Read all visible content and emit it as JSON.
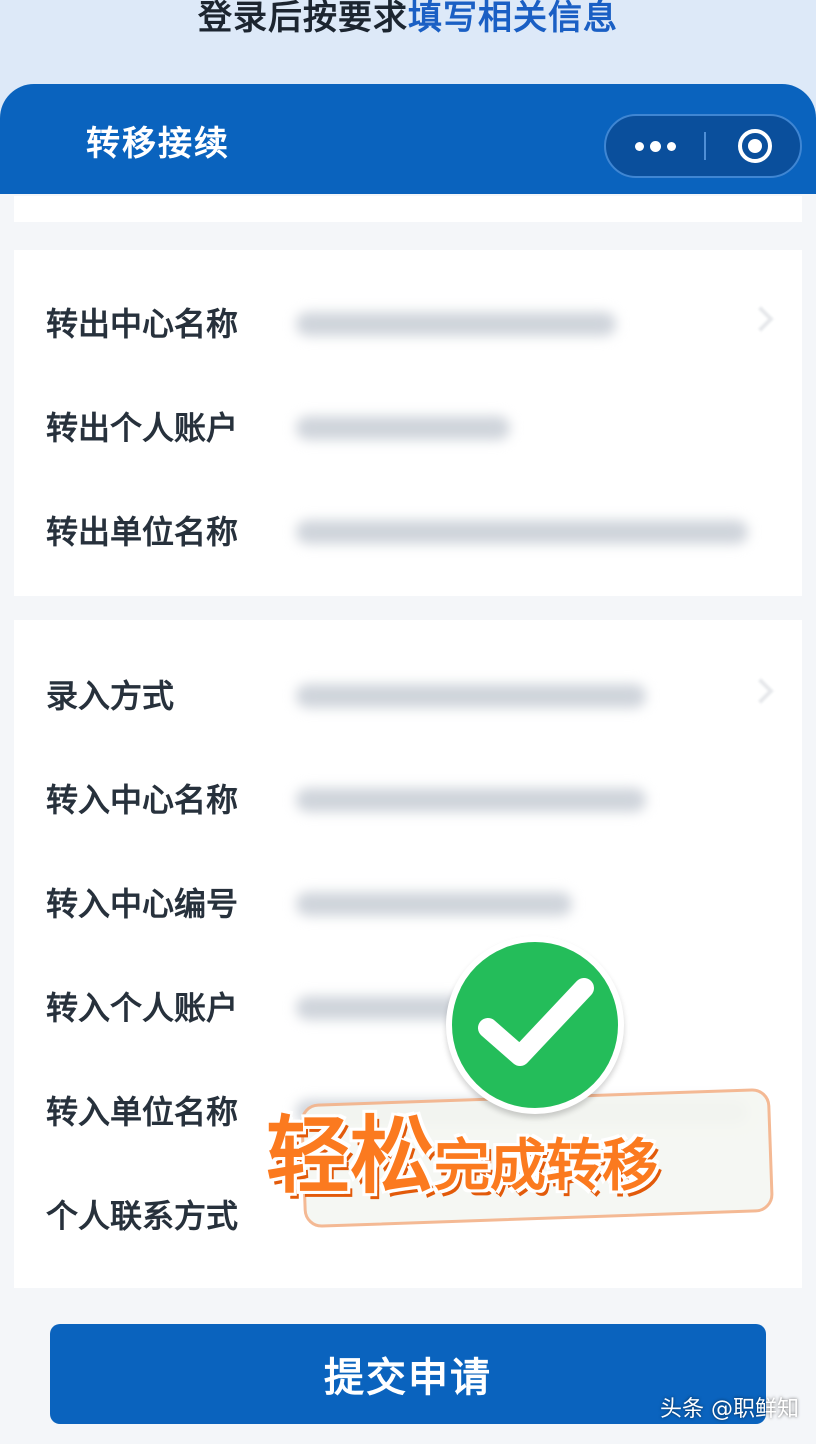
{
  "caption": {
    "text_black": "登录后按要求",
    "text_blue": "填写相关信息"
  },
  "navbar": {
    "title": "转移接续",
    "more_icon": "more-dots-icon",
    "close_icon": "target-close-icon"
  },
  "section_out": {
    "fields": [
      {
        "label": "转出中心名称"
      },
      {
        "label": "转出个人账户"
      },
      {
        "label": "转出单位名称"
      }
    ]
  },
  "section_in": {
    "fields": [
      {
        "label": "录入方式"
      },
      {
        "label": "转入中心名称"
      },
      {
        "label": "转入中心编号"
      },
      {
        "label": "转入个人账户"
      },
      {
        "label": "转入单位名称"
      },
      {
        "label": "个人联系方式"
      }
    ]
  },
  "promo": {
    "text_big": "轻松",
    "text_small": "完成转移",
    "icon": "check-icon"
  },
  "submit": {
    "label": "提交申请"
  },
  "watermark": {
    "text": "头条 @职鲜知"
  },
  "colors": {
    "nav": "#0a63be",
    "accent": "#1a5fc4",
    "check": "#24bd5a",
    "promo": "#fb7a1f"
  }
}
